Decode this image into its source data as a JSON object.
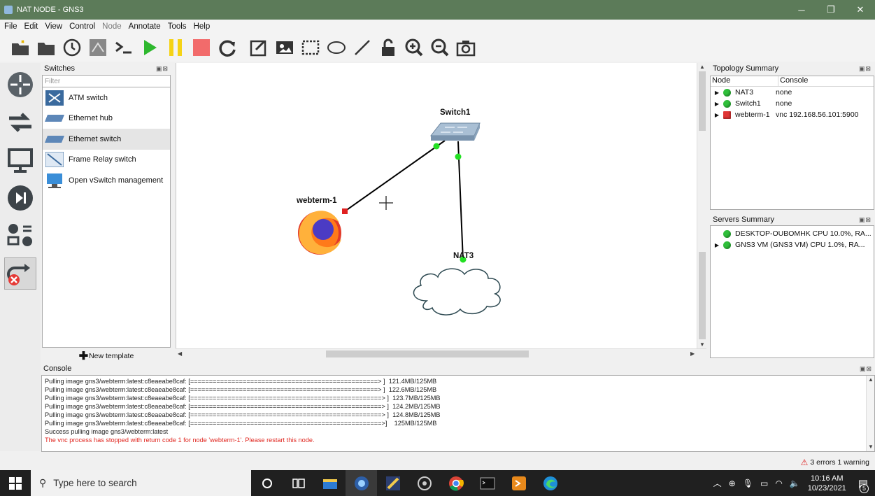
{
  "window": {
    "title": "NAT NODE - GNS3",
    "min": "─",
    "restore": "❐",
    "close": "✕"
  },
  "menu": [
    {
      "label": "File",
      "disabled": false
    },
    {
      "label": "Edit",
      "disabled": false
    },
    {
      "label": "View",
      "disabled": false
    },
    {
      "label": "Control",
      "disabled": false
    },
    {
      "label": "Node",
      "disabled": true
    },
    {
      "label": "Annotate",
      "disabled": false
    },
    {
      "label": "Tools",
      "disabled": false
    },
    {
      "label": "Help",
      "disabled": false
    }
  ],
  "devices_panel": {
    "title": "Switches",
    "filter_placeholder": "Filter",
    "items": [
      {
        "label": "ATM switch"
      },
      {
        "label": "Ethernet hub"
      },
      {
        "label": "Ethernet switch"
      },
      {
        "label": "Frame Relay switch"
      },
      {
        "label": "Open vSwitch management"
      }
    ],
    "new_template": "New template"
  },
  "topology": {
    "nodes": {
      "switch": "Switch1",
      "webterm": "webterm-1",
      "nat": "NAT3"
    }
  },
  "topology_summary": {
    "title": "Topology Summary",
    "col_node": "Node",
    "col_console": "Console",
    "rows": [
      {
        "node": "NAT3",
        "console": "none",
        "status": "green"
      },
      {
        "node": "Switch1",
        "console": "none",
        "status": "green"
      },
      {
        "node": "webterm-1",
        "console": "vnc 192.168.56.101:5900",
        "status": "red"
      }
    ]
  },
  "servers_summary": {
    "title": "Servers Summary",
    "rows": [
      {
        "label": "DESKTOP-OUBOMHK CPU 10.0%, RA..."
      },
      {
        "label": "GNS3 VM (GNS3 VM) CPU 1.0%, RA..."
      }
    ]
  },
  "console": {
    "title": "Console",
    "lines": [
      "Pulling image gns3/webterm:latest:c8eaeabe8caf: [==================================================> ]  121.4MB/125MB",
      "Pulling image gns3/webterm:latest:c8eaeabe8caf: [==================================================> ]  122.6MB/125MB",
      "Pulling image gns3/webterm:latest:c8eaeabe8caf: [===================================================> ]  123.7MB/125MB",
      "Pulling image gns3/webterm:latest:c8eaeabe8caf: [===================================================> ]  124.2MB/125MB",
      "Pulling image gns3/webterm:latest:c8eaeabe8caf: [===================================================> ]  124.8MB/125MB",
      "Pulling image gns3/webterm:latest:c8eaeabe8caf: [===================================================>]    125MB/125MB",
      "Success pulling image gns3/webterm:latest"
    ],
    "error_line": "The vnc process has stopped with return code 1 for node 'webterm-1'. Please restart this node."
  },
  "status_bar": {
    "text": "3 errors 1 warning"
  },
  "taskbar": {
    "search_placeholder": "Type here to search",
    "time": "10:16 AM",
    "date": "10/23/2021",
    "notification_count": "5"
  },
  "colors": {
    "titlebar": "#5c7b59",
    "status_green": "#2fbf3a",
    "status_red": "#e03535",
    "error_text": "#e0261f"
  }
}
